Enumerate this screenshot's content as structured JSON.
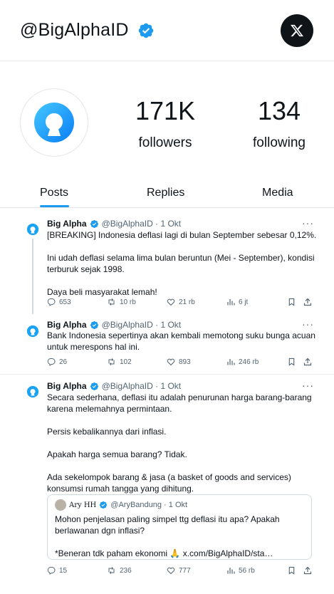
{
  "profile": {
    "handle": "@BigAlphaID",
    "followers_count": "171K",
    "followers_label": "followers",
    "following_count": "134",
    "following_label": "following",
    "brand_color": "#1d9bf0"
  },
  "tabs": [
    {
      "label": "Posts",
      "active": true
    },
    {
      "label": "Replies",
      "active": false
    },
    {
      "label": "Media",
      "active": false
    }
  ],
  "tweets": [
    {
      "name": "Big Alpha",
      "meta": "@BigAlphaID · 1 Okt",
      "paragraphs": [
        "[BREAKING] Indonesia deflasi lagi di bulan September sebesar 0,12%.",
        "Ini udah deflasi selama lima bulan beruntun (Mei - September), kondisi terburuk sejak 1998.",
        "Daya beli masyarakat lemah!"
      ],
      "replies": "653",
      "reposts": "10 rb",
      "likes": "21 rb",
      "views": "6 jt"
    },
    {
      "name": "Big Alpha",
      "meta": "@BigAlphaID · 1 Okt",
      "paragraphs": [
        "Bank Indonesia sepertinya akan kembali memotong suku bunga acuan untuk merespons hal ini."
      ],
      "replies": "26",
      "reposts": "102",
      "likes": "893",
      "views": "246 rb"
    },
    {
      "name": "Big Alpha",
      "meta": "@BigAlphaID · 1 Okt",
      "paragraphs": [
        "Secara sederhana, deflasi itu adalah penurunan harga barang-barang karena melemahnya permintaan.",
        "Persis kebalikannya dari inflasi.",
        "Apakah harga semua barang? Tidak.",
        "Ada sekelompok barang & jasa (a basket of goods and services) konsumsi rumah tangga yang dihitung."
      ],
      "quote": {
        "name": "Ary HH",
        "handle_meta": "@AryBandung · 1 Okt",
        "paragraphs": [
          "Mohon penjelasan paling simpel ttg deflasi itu apa? Apakah berlawanan dgn inflasi?",
          "*Beneran tdk paham ekonomi 🙏 x.com/BigAlphaID/sta…"
        ]
      },
      "replies": "15",
      "reposts": "236",
      "likes": "777",
      "views": "56 rb"
    }
  ]
}
